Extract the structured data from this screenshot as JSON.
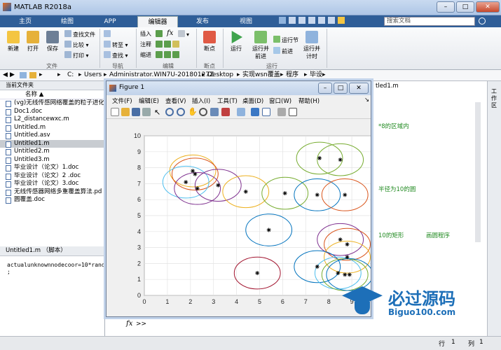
{
  "window": {
    "title": "MATLAB R2018a"
  },
  "tabs": [
    "主页",
    "绘图",
    "APP",
    "编辑器",
    "发布",
    "视图"
  ],
  "active_tab": "编辑器",
  "search_placeholder": "搜索文档",
  "ribbon": {
    "new": "新建",
    "open": "打开",
    "save": "保存",
    "find_files": "查找文件",
    "compare": "比较",
    "print": "打印",
    "file_group": "文件",
    "goto": "转至",
    "find": "查找",
    "nav_group": "导航",
    "insert": "插入",
    "comment": "注释",
    "indent": "缩进",
    "fx": "fx",
    "edit_group": "编辑",
    "breakpoint": "断点",
    "bp_group": "断点",
    "run": "运行",
    "run_advance": "运行并\n前进",
    "run_section": "运行节",
    "advance": "前进",
    "run_time": "运行并\n计时",
    "run_group": "运行"
  },
  "address": {
    "parts": [
      "C:",
      "Users",
      "Administrator.WIN7U-20180127Z",
      "Desktop",
      "实现wsn覆盖",
      "程序",
      "毕设"
    ]
  },
  "current_folder": {
    "title": "当前文件夹",
    "column": "名称",
    "files": [
      "(vg)无线传感网络覆盖的粒子进化",
      "Doc1.doc",
      "L2_distancewxc.m",
      "Untitled.m",
      "Untitled.asv",
      "Untitled1.m",
      "Untitled2.m",
      "Untitled3.m",
      "毕业设计（论文）1.doc",
      "毕业设计（论文）2 .doc",
      "毕业设计（论文）3.doc",
      "无线传感器网络多重覆盖算法.pd",
      "圆覆盖.doc"
    ],
    "selected_index": 5
  },
  "details": {
    "title": "Untitled1.m （脚本）",
    "code": "actualunknownnodecoor=10*rand(",
    "code2": ";"
  },
  "editor_bg": {
    "tab": "tled1.m",
    "line1": "*8的区域内",
    "line2": "半径为10的圆",
    "line3": "10的矩形",
    "line4": "画圆程序"
  },
  "right_strip": "工作区",
  "figure": {
    "title": "Figure 1",
    "menus": [
      "文件(F)",
      "编辑(E)",
      "查看(V)",
      "插入(I)",
      "工具(T)",
      "桌面(D)",
      "窗口(W)",
      "帮助(H)"
    ]
  },
  "chart_data": {
    "type": "scatter",
    "title": "",
    "xlabel": "",
    "ylabel": "",
    "xlim": [
      0,
      10
    ],
    "ylim": [
      0,
      10
    ],
    "xticks": [
      "0",
      "1",
      "2",
      "3",
      "4",
      "5",
      "6",
      "7",
      "8",
      "9",
      "10"
    ],
    "yticks": [
      "0",
      "1",
      "2",
      "3",
      "4",
      "5",
      "6",
      "7",
      "8",
      "9",
      "10"
    ],
    "grid": true,
    "circle_radius": 1,
    "points": [
      {
        "x": 8.5,
        "y": 8.5,
        "color": "#77ac30"
      },
      {
        "x": 7.6,
        "y": 8.6,
        "color": "#77ac30"
      },
      {
        "x": 2.1,
        "y": 7.8,
        "color": "#edb120"
      },
      {
        "x": 2.2,
        "y": 7.6,
        "color": "#d95319"
      },
      {
        "x": 1.8,
        "y": 7.1,
        "color": "#4dbeee"
      },
      {
        "x": 2.3,
        "y": 6.7,
        "color": "#7e2f8e"
      },
      {
        "x": 3.2,
        "y": 6.9,
        "color": "#7e2f8e"
      },
      {
        "x": 4.4,
        "y": 6.5,
        "color": "#edb120"
      },
      {
        "x": 6.1,
        "y": 6.4,
        "color": "#77ac30"
      },
      {
        "x": 7.5,
        "y": 6.3,
        "color": "#0072bd"
      },
      {
        "x": 8.7,
        "y": 6.3,
        "color": "#d95319"
      },
      {
        "x": 5.4,
        "y": 4.1,
        "color": "#0072bd"
      },
      {
        "x": 8.5,
        "y": 3.5,
        "color": "#7e2f8e"
      },
      {
        "x": 8.8,
        "y": 3.2,
        "color": "#d95319"
      },
      {
        "x": 8.8,
        "y": 2.4,
        "color": "#edb120"
      },
      {
        "x": 7.5,
        "y": 1.8,
        "color": "#0072bd"
      },
      {
        "x": 4.9,
        "y": 1.4,
        "color": "#a2142f"
      },
      {
        "x": 8.4,
        "y": 1.4,
        "color": "#4dbeee"
      },
      {
        "x": 8.7,
        "y": 1.3,
        "color": "#77ac30"
      },
      {
        "x": 8.9,
        "y": 1.3,
        "color": "#0072bd"
      }
    ]
  },
  "command": {
    "prompt": ">>",
    "fx": "fx"
  },
  "status": {
    "row_label": "行",
    "row": "1",
    "col_label": "列",
    "col": "1"
  },
  "watermark": {
    "text": "必过源码",
    "url": "Biguo100.com"
  },
  "colors": {
    "tabbar": "#2f5e98",
    "accent": "#edb120"
  }
}
